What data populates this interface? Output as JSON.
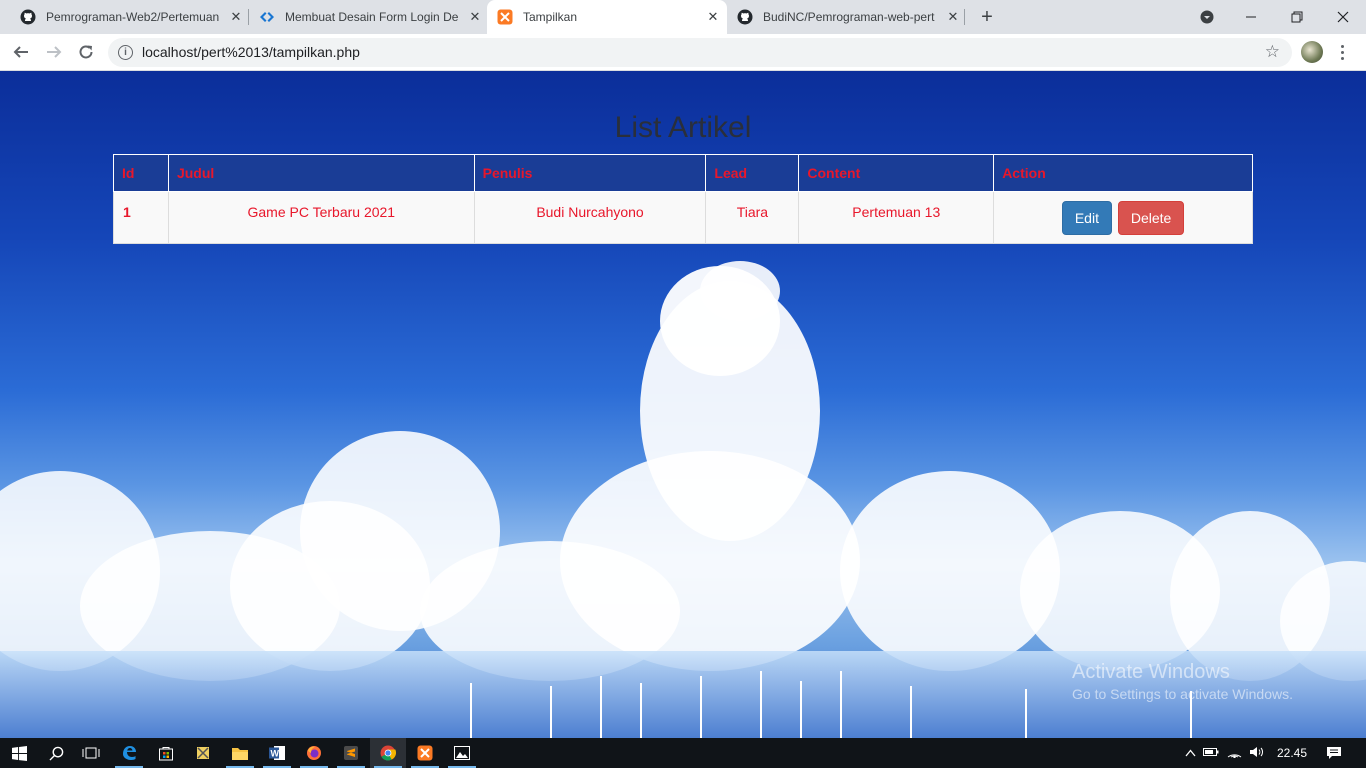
{
  "browser": {
    "tabs": [
      {
        "title": "Pemrograman-Web2/Pertemuan",
        "icon": "github-icon"
      },
      {
        "title": "Membuat Desain Form Login Der",
        "icon": "code-icon"
      },
      {
        "title": "Tampilkan",
        "icon": "xampp-icon"
      },
      {
        "title": "BudiNC/Pemrograman-web-pert",
        "icon": "github-icon"
      }
    ],
    "url": "localhost/pert%2013/tampilkan.php"
  },
  "page": {
    "title": "List Artikel",
    "table": {
      "headers": [
        "Id",
        "Judul",
        "Penulis",
        "Lead",
        "Content",
        "Action"
      ],
      "rows": [
        {
          "id": "1",
          "judul": "Game PC Terbaru 2021",
          "penulis": "Budi Nurcahyono",
          "lead": "Tiara",
          "content": "Pertemuan 13"
        }
      ],
      "edit_label": "Edit",
      "delete_label": "Delete"
    },
    "watermark": {
      "line1": "Activate Windows",
      "line2": "Go to Settings to activate Windows."
    }
  },
  "taskbar": {
    "clock": "22.45"
  },
  "colors": {
    "header_bg": "#1a3d96",
    "text_red": "#e8172b",
    "edit_btn": "#337ab7",
    "delete_btn": "#d9534f"
  }
}
